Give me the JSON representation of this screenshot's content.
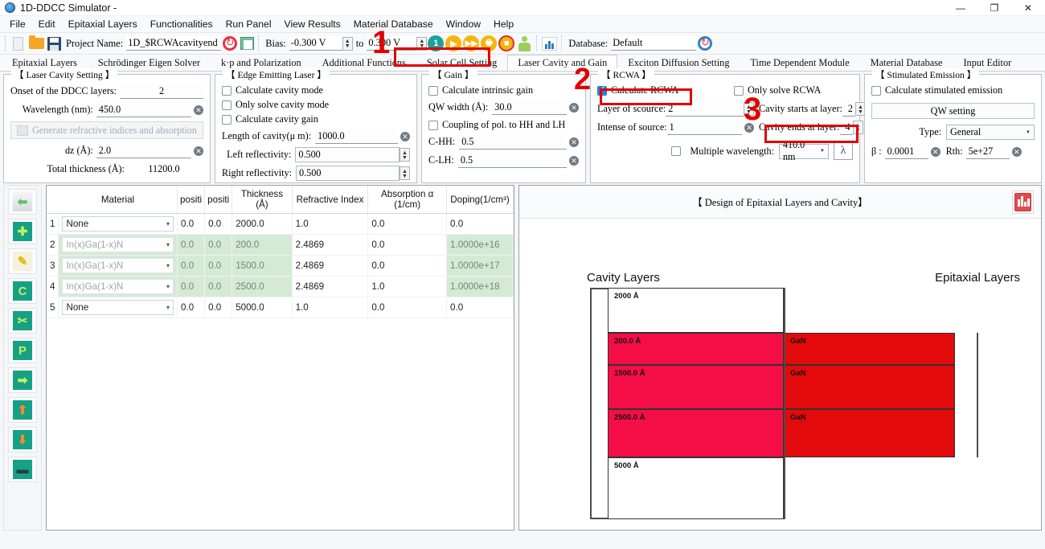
{
  "window": {
    "title": "1D-DDCC Simulator -",
    "minimize": "—",
    "maximize": "❐",
    "close": "✕"
  },
  "menubar": {
    "items": [
      "File",
      "Edit",
      "Epitaxial Layers",
      "Functionalities",
      "Run Panel",
      "View Results",
      "Material Database",
      "Window",
      "Help"
    ]
  },
  "toolbar": {
    "project_label": "Project Name:",
    "project_value": "1D_$RCWAcavityend",
    "bias_label": "Bias:",
    "bias_from": "-0.300 V",
    "bias_to_label": "to",
    "bias_to": "0.300 V",
    "step_badge": "1",
    "database_label": "Database:",
    "database_value": "Default",
    "icons": [
      "new-document-icon",
      "open-folder-icon",
      "save-icon",
      "refresh-icon",
      "library-icon",
      "step-icon",
      "run-icon",
      "run-all-icon",
      "print-run-icon",
      "stop-icon",
      "user-icon",
      "results-chart-icon",
      "database-refresh-icon"
    ]
  },
  "tabs": {
    "items": [
      "Epitaxial Layers",
      "Schrödinger Eigen Solver",
      "k·p and Polarization",
      "Additional Functions",
      "Solar Cell Setting",
      "Laser Cavity and Gain",
      "Exciton Diffusion Setting",
      "Time Dependent Module",
      "Material Database",
      "Input Editor"
    ],
    "active": "Laser Cavity and Gain"
  },
  "laser_cavity_setting": {
    "legend": "【 Laser Cavity Setting 】",
    "onset_label": "Onset of the DDCC layers:",
    "onset_value": "2",
    "wavelength_label": "Wavelength (nm):",
    "wavelength_value": "450.0",
    "generate_button": "Generate refractive indices and absorption",
    "dz_label": "dz (Å):",
    "dz_value": "2.0",
    "total_thickness_label": "Total thickness (Å):",
    "total_thickness_value": "11200.0"
  },
  "edge_emitting_laser": {
    "legend": "【 Edge Emitting Laser 】",
    "checkboxes": [
      {
        "label": "Calculate cavity mode",
        "checked": false
      },
      {
        "label": "Only solve cavity mode",
        "checked": false
      },
      {
        "label": "Calculate cavity gain",
        "checked": false
      }
    ],
    "length_label": "Length of cavity(μ m):",
    "length_value": "1000.0",
    "left_refl_label": "Left reflectivity:",
    "left_refl_value": "0.500",
    "right_refl_label": "Right reflectivity:",
    "right_refl_value": "0.500"
  },
  "gain": {
    "legend": "【 Gain 】",
    "intrinsic_gain_label": "Calculate intrinsic gain",
    "intrinsic_gain_checked": false,
    "qw_width_label": "QW width (Å):",
    "qw_width_value": "30.0",
    "coupling_label": "Coupling of pol. to HH and LH",
    "coupling_checked": false,
    "chh_label": "C-HH:",
    "chh_value": "0.5",
    "clh_label": "C-LH:",
    "clh_value": "0.5"
  },
  "rcwa": {
    "legend": "【 RCWA 】",
    "calculate_label": "Calculate RCWA",
    "calculate_checked": true,
    "only_solve_label": "Only solve RCWA",
    "only_solve_checked": false,
    "layer_of_source_label": "Layer of scource:",
    "layer_of_source_value": "2",
    "intense_of_source_label": "Intense of source:",
    "intense_of_source_value": "1",
    "cavity_starts_label": "Cavity starts at layer:",
    "cavity_starts_value": "2",
    "cavity_ends_label": "Cavity ends at layer:",
    "cavity_ends_value": "4",
    "multiple_wavelength_label": "Multiple wavelength:",
    "multiple_wavelength_checked": false,
    "wavelength_option": "410.0 nm",
    "lambda_button": "λ"
  },
  "stimulated_emission": {
    "legend": "【 Stimulated Emission 】",
    "calculate_label": "Calculate stimulated emission",
    "calculate_checked": false,
    "qw_setting_button": "QW setting",
    "type_label": "Type:",
    "type_value": "General",
    "beta_label": "β :",
    "beta_value": "0.0001",
    "rth_label": "Rth:",
    "rth_value": "5e+27"
  },
  "sidebar": {
    "items": [
      {
        "name": "load-layers-button",
        "glyph": "⬅"
      },
      {
        "name": "add-layer-button",
        "glyph": "✚"
      },
      {
        "name": "edit-layer-button",
        "glyph": "✎"
      },
      {
        "name": "copy-layer-button",
        "glyph": "C"
      },
      {
        "name": "cut-layer-button",
        "glyph": "✂"
      },
      {
        "name": "paste-layer-button",
        "glyph": "P"
      },
      {
        "name": "insert-layer-button",
        "glyph": "➡"
      },
      {
        "name": "move-layer-up-button",
        "glyph": "⬆"
      },
      {
        "name": "move-layer-down-button",
        "glyph": "⬇"
      },
      {
        "name": "delete-layer-button",
        "glyph": "▬"
      }
    ]
  },
  "layer_table": {
    "columns": [
      "Material",
      "positi",
      "positi",
      "Thickness (Å)",
      "Refractive Index",
      "Absorption α (1/cm)",
      "Doping(1/cm³)"
    ],
    "rows": [
      {
        "n": "1",
        "material": "None",
        "pos1": "0.0",
        "pos2": "0.0",
        "thickness": "2000.0",
        "refractive_index": "1.0",
        "absorption": "0.0",
        "doping": "0.0",
        "highlight": false
      },
      {
        "n": "2",
        "material": "In(x)Ga(1-x)N",
        "pos1": "0.0",
        "pos2": "0.0",
        "thickness": "200.0",
        "refractive_index": "2.4869",
        "absorption": "0.0",
        "doping": "1.0000e+16",
        "highlight": true
      },
      {
        "n": "3",
        "material": "In(x)Ga(1-x)N",
        "pos1": "0.0",
        "pos2": "0.0",
        "thickness": "1500.0",
        "refractive_index": "2.4869",
        "absorption": "0.0",
        "doping": "1.0000e+17",
        "highlight": true
      },
      {
        "n": "4",
        "material": "In(x)Ga(1-x)N",
        "pos1": "0.0",
        "pos2": "0.0",
        "thickness": "2500.0",
        "refractive_index": "2.4869",
        "absorption": "1.0",
        "doping": "1.0000e+18",
        "highlight": true
      },
      {
        "n": "5",
        "material": "None",
        "pos1": "0.0",
        "pos2": "0.0",
        "thickness": "5000.0",
        "refractive_index": "1.0",
        "absorption": "0.0",
        "doping": "0.0",
        "highlight": false
      }
    ]
  },
  "viewer": {
    "title": "【 Design of Epitaxial Layers and Cavity】",
    "chart_button": "results-chart-icon",
    "cavity_header": "Cavity Layers",
    "epitaxial_header": "Epitaxial Layers",
    "cavity_layers": [
      {
        "label": "2000 Å",
        "filled": false
      },
      {
        "label": "200.0 Å",
        "filled": true
      },
      {
        "label": "1500.0 Å",
        "filled": true
      },
      {
        "label": "2500.0 Å",
        "filled": true
      },
      {
        "label": "5000 Å",
        "filled": false
      }
    ],
    "epitaxial_layers": [
      {
        "label": "",
        "filled": false
      },
      {
        "label": "GaN",
        "filled": true
      },
      {
        "label": "GaN",
        "filled": true
      },
      {
        "label": "GaN",
        "filled": true
      },
      {
        "label": "",
        "filled": false
      }
    ],
    "cavity_fill_color": "#f50d46",
    "epitaxial_fill_color": "#e20a0a"
  },
  "annotations": {
    "color": "#e00000",
    "numbers": [
      "1",
      "2",
      "3"
    ],
    "boxes": [
      "laser-cavity-and-gain-tab",
      "calculate-rcwa-checkbox",
      "cavity-ends-at-layer-field"
    ]
  }
}
